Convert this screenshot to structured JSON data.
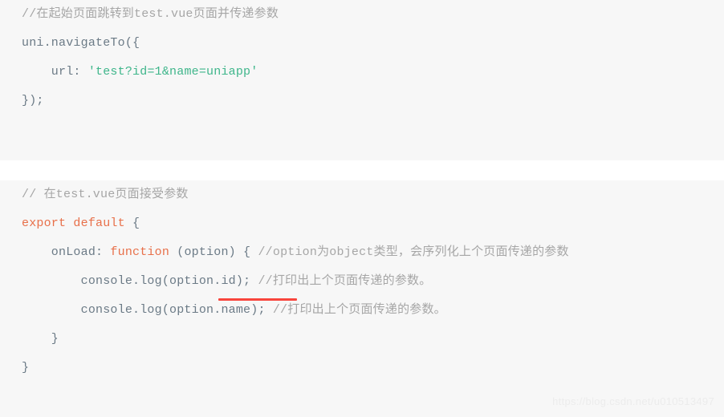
{
  "theme": {
    "page_background": "#ffffff",
    "code_background": "#f7f7f7",
    "comment_color": "#a6a6a6",
    "plain_color": "#6b7a86",
    "string_color": "#3fb68b",
    "keyword_color": "#e8704a",
    "marker_color": "#f8453c",
    "watermark_color": "#ececec"
  },
  "blocks": [
    {
      "id": "navigate-to-snippet",
      "lines": [
        {
          "id": "line-1-1",
          "text": "//在起始页面跳转到test.vue页面并传递参数",
          "tokens": [
            {
              "text": "//在起始页面跳转到test.vue页面并传递参数",
              "type": "comment"
            }
          ]
        },
        {
          "id": "line-1-2",
          "text": "uni.navigateTo({",
          "tokens": [
            {
              "text": "uni.navigateTo({",
              "type": "plain"
            }
          ]
        },
        {
          "id": "line-1-3",
          "text": "    url: 'test?id=1&name=uniapp'",
          "tokens": [
            {
              "text": "    url: ",
              "type": "plain"
            },
            {
              "text": "'test?id=1&name=uniapp'",
              "type": "string"
            }
          ]
        },
        {
          "id": "line-1-4",
          "text": "});",
          "tokens": [
            {
              "text": "});",
              "type": "plain"
            }
          ]
        }
      ]
    },
    {
      "id": "onload-snippet",
      "lines": [
        {
          "id": "line-2-1",
          "text": "// 在test.vue页面接受参数",
          "tokens": [
            {
              "text": "// 在test.vue页面接受参数",
              "type": "comment"
            }
          ]
        },
        {
          "id": "line-2-2",
          "text": "export default {",
          "tokens": [
            {
              "text": "export default",
              "type": "keyword"
            },
            {
              "text": " {",
              "type": "plain"
            }
          ]
        },
        {
          "id": "line-2-3",
          "text": "    onLoad: function (option) { //option为object类型，会序列化上个页面传递的参数",
          "tokens": [
            {
              "text": "    onLoad: ",
              "type": "plain"
            },
            {
              "text": "function",
              "type": "keyword"
            },
            {
              "text": " (option) { ",
              "type": "plain"
            },
            {
              "text": "//option为object类型，会序列化上个页面传递的参数",
              "type": "comment"
            }
          ]
        },
        {
          "id": "line-2-4",
          "text": "        console.log(option.id); //打印出上个页面传递的参数。",
          "tokens": [
            {
              "text": "        console.log(option.id); ",
              "type": "plain"
            },
            {
              "text": "//打印出上个页面传递的参数。",
              "type": "comment"
            }
          ]
        },
        {
          "id": "line-2-5",
          "text": "        console.log(option.name); //打印出上个页面传递的参数。",
          "tokens": [
            {
              "text": "        console.log(option.name); ",
              "type": "plain"
            },
            {
              "text": "//打印出上个页面传递的参数。",
              "type": "comment"
            }
          ]
        },
        {
          "id": "line-2-6",
          "text": "    }",
          "tokens": [
            {
              "text": "    }",
              "type": "plain"
            }
          ]
        },
        {
          "id": "line-2-7",
          "text": "}",
          "tokens": [
            {
              "text": "}",
              "type": "plain"
            }
          ]
        }
      ]
    }
  ],
  "annotations": {
    "option_underline": {
      "label": "option",
      "color": "#f8453c"
    }
  },
  "watermark": {
    "text": "https://blog.csdn.net/u010513497"
  }
}
